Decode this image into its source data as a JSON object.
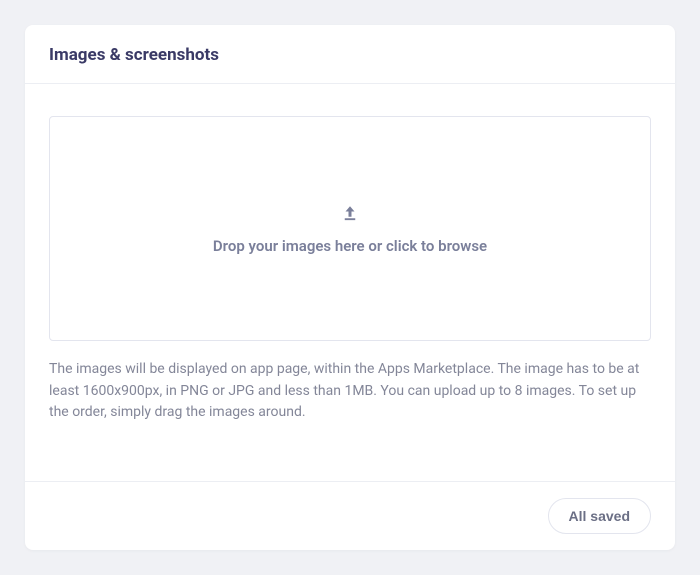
{
  "card": {
    "title": "Images & screenshots",
    "dropzone": {
      "text": "Drop your images here or click to browse",
      "icon": "upload-icon"
    },
    "help_text": "The images will be displayed on app page, within the Apps Marketplace. The image has to be at least 1600x900px, in PNG or JPG and less than 1MB. You can upload up to 8 images. To set up the order, simply drag the images around.",
    "footer": {
      "status_label": "All saved"
    }
  }
}
